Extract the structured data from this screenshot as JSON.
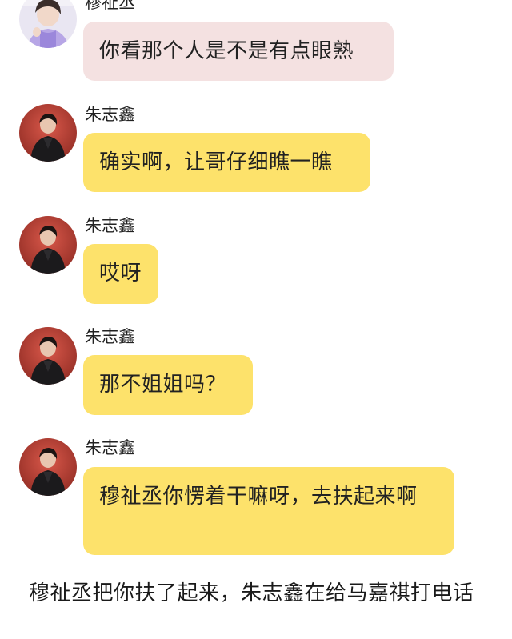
{
  "conversation": {
    "messages": [
      {
        "sender": "穆祉丞",
        "avatar_icon": "avatar-girl-lavender",
        "bubble_color": "#f4e1e1",
        "text": "你看那个人是不是有点眼熟"
      },
      {
        "sender": "朱志鑫",
        "avatar_icon": "avatar-red-portrait",
        "bubble_color": "#fde26b",
        "text": "确实啊，让哥仔细瞧一瞧"
      },
      {
        "sender": "朱志鑫",
        "avatar_icon": "avatar-red-portrait",
        "bubble_color": "#fde26b",
        "text": "哎呀"
      },
      {
        "sender": "朱志鑫",
        "avatar_icon": "avatar-red-portrait",
        "bubble_color": "#fde26b",
        "text": "那不姐姐吗？"
      },
      {
        "sender": "朱志鑫",
        "avatar_icon": "avatar-red-portrait",
        "bubble_color": "#fde26b",
        "text": "穆祉丞你愣着干嘛呀，去扶起来啊"
      }
    ],
    "narration": "穆祉丞把你扶了起来，朱志鑫在给马嘉祺打电话"
  }
}
